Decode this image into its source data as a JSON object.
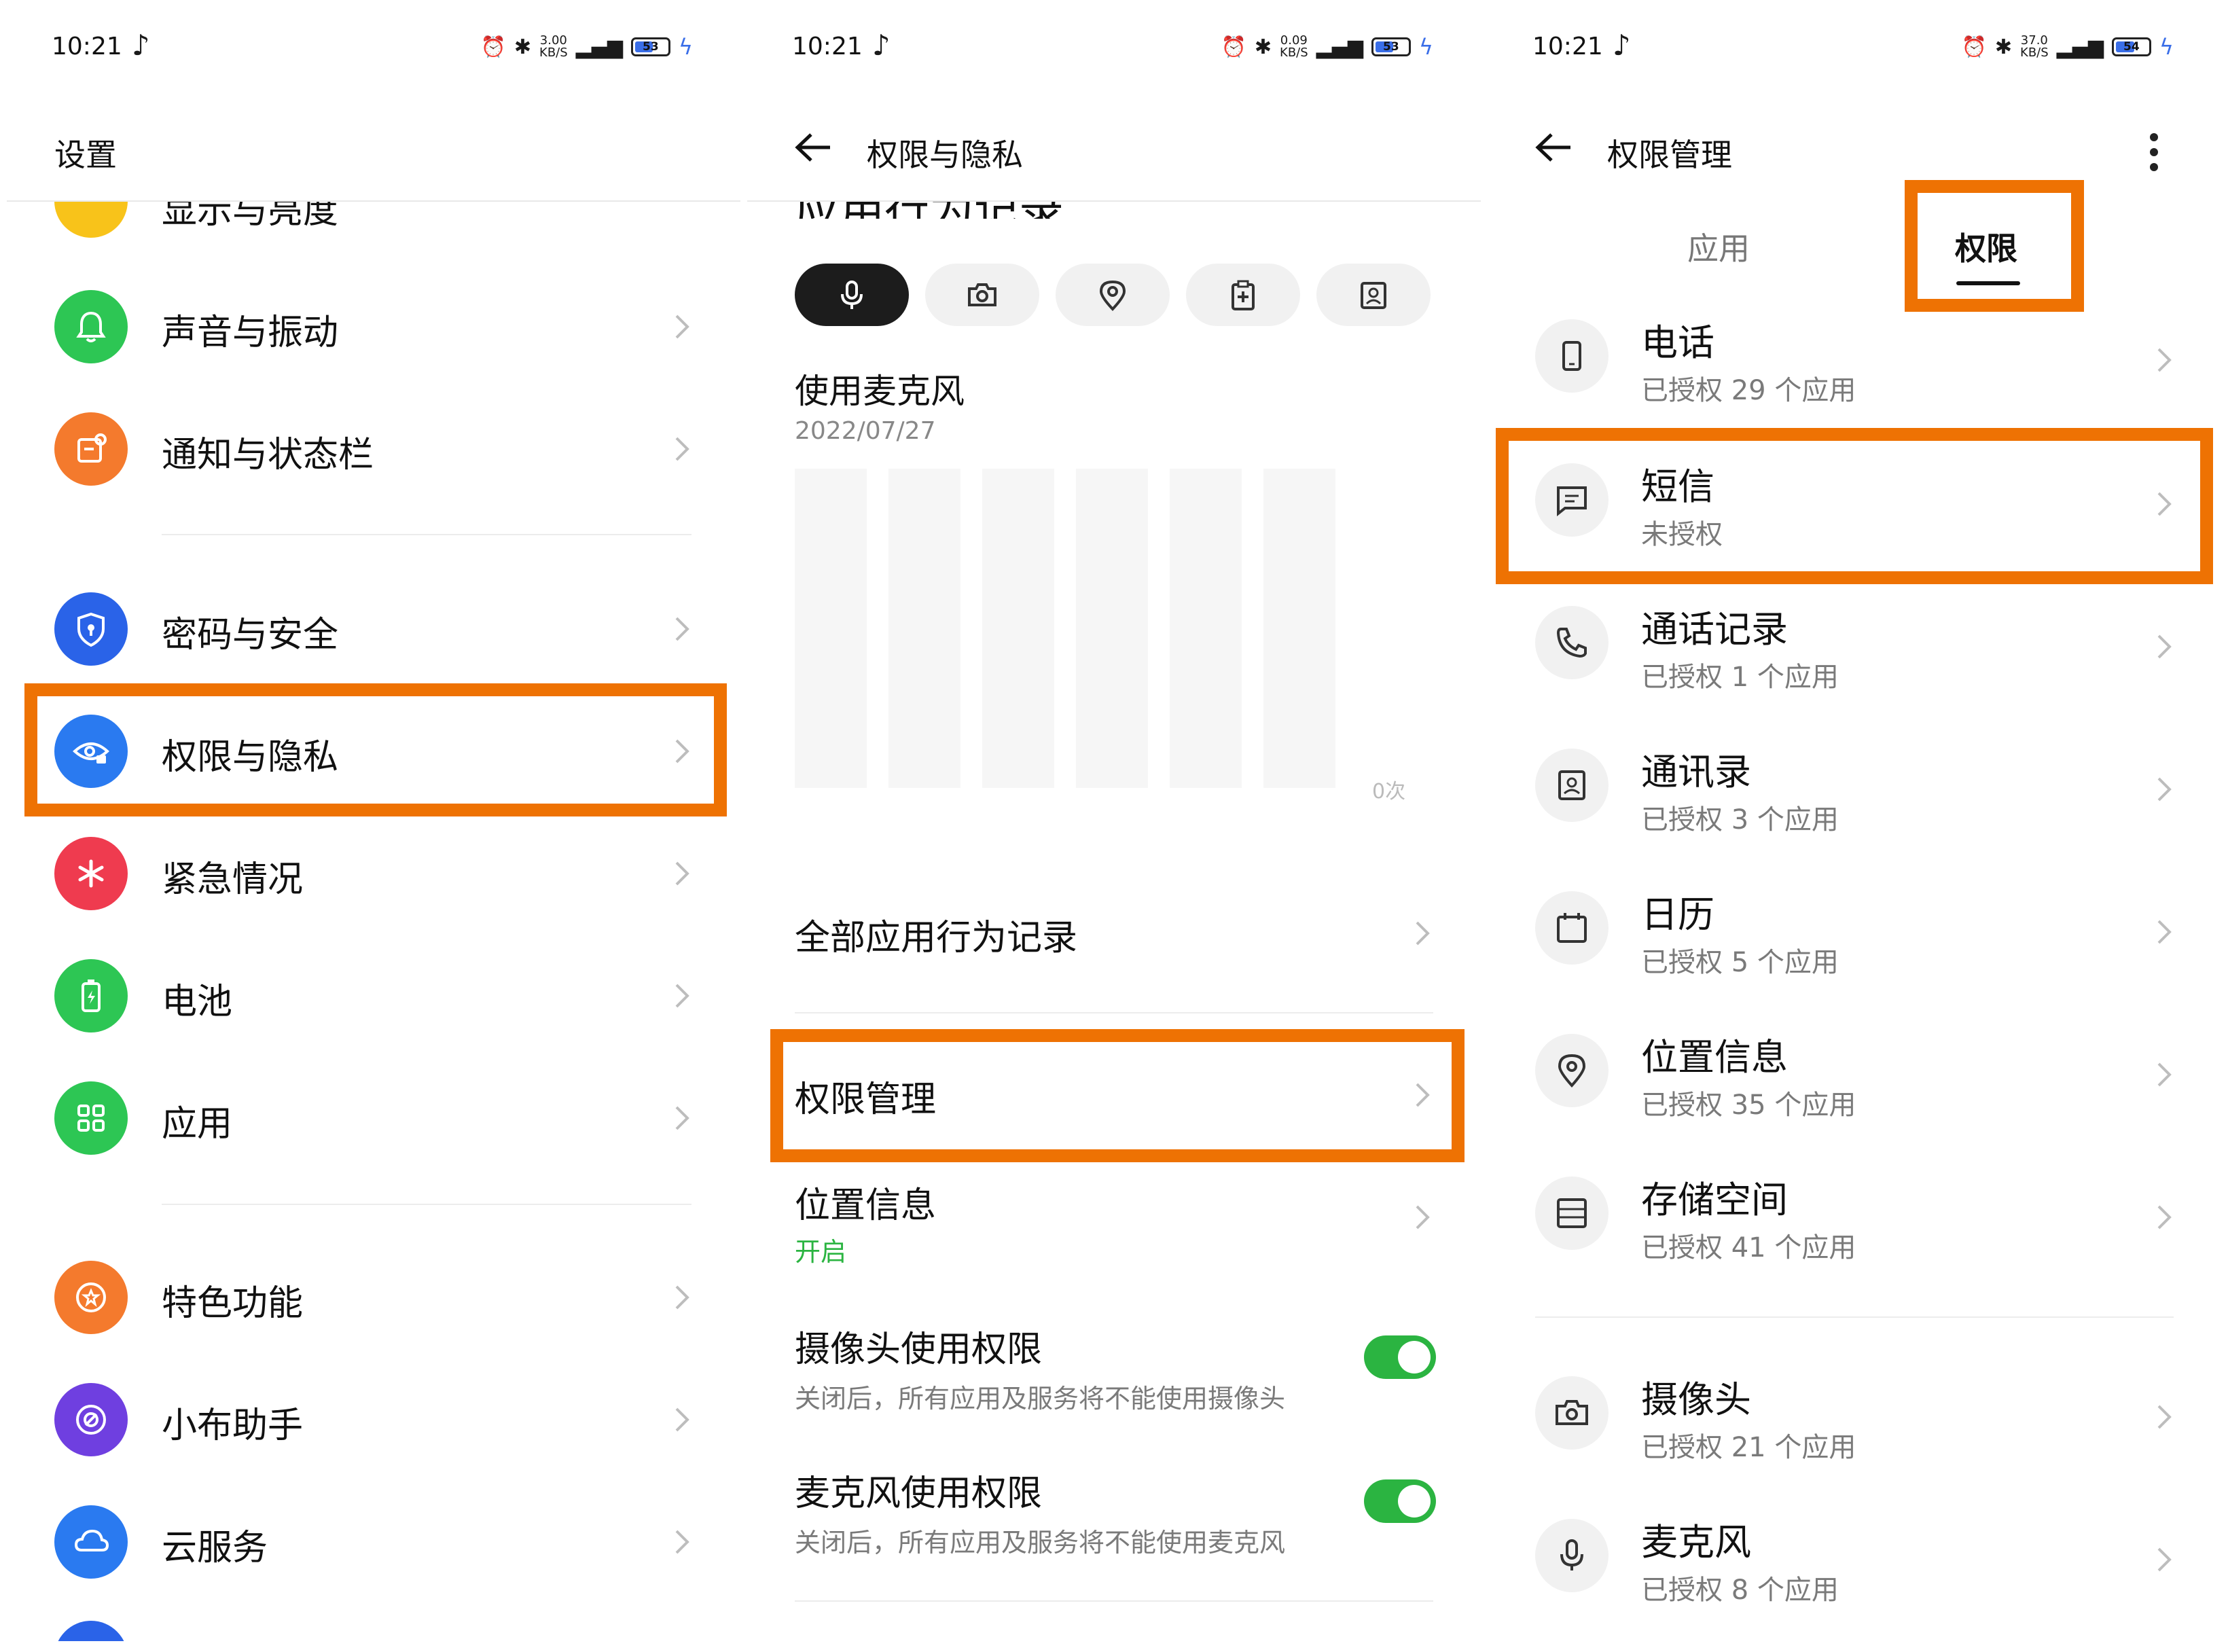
{
  "status": {
    "time": "10:21"
  },
  "panel1": {
    "title": "设置",
    "partial_item": "显示与亮度",
    "items": [
      {
        "label": "声音与振动",
        "color": "#2dc654"
      },
      {
        "label": "通知与状态栏",
        "color": "#f47a2d"
      },
      {
        "label": "密码与安全",
        "color": "#2a63e8"
      },
      {
        "label": "权限与隐私",
        "color": "#2a7af0"
      },
      {
        "label": "紧急情况",
        "color": "#ef3b4f"
      },
      {
        "label": "电池",
        "color": "#2dc654"
      },
      {
        "label": "应用",
        "color": "#2dc654"
      },
      {
        "label": "特色功能",
        "color": "#f47a2d"
      },
      {
        "label": "小布助手",
        "color": "#6f3fe0"
      },
      {
        "label": "云服务",
        "color": "#2a7af0"
      }
    ]
  },
  "panel2": {
    "title": "权限与隐私",
    "partial_heading": "应用行为记录",
    "usage_title": "使用麦克风",
    "usage_date": "2022/07/27",
    "chart_axis_label": "0次",
    "all_records": "全部应用行为记录",
    "permission_mgmt": "权限管理",
    "location_title": "位置信息",
    "location_status": "开启",
    "camera_title": "摄像头使用权限",
    "camera_sub": "关闭后，所有应用及服务将不能使用摄像头",
    "mic_title": "麦克风使用权限",
    "mic_sub": "关闭后，所有应用及服务将不能使用麦克风",
    "accent_green": "#2bb441"
  },
  "panel3": {
    "title": "权限管理",
    "tab_apps": "应用",
    "tab_perms": "权限",
    "items": [
      {
        "title": "电话",
        "sub": "已授权 29 个应用"
      },
      {
        "title": "短信",
        "sub": "未授权"
      },
      {
        "title": "通话记录",
        "sub": "已授权 1 个应用"
      },
      {
        "title": "通讯录",
        "sub": "已授权 3 个应用"
      },
      {
        "title": "日历",
        "sub": "已授权 5 个应用"
      },
      {
        "title": "位置信息",
        "sub": "已授权 35 个应用"
      },
      {
        "title": "存储空间",
        "sub": "已授权 41 个应用"
      },
      {
        "title": "摄像头",
        "sub": "已授权 21 个应用"
      },
      {
        "title": "麦克风",
        "sub": "已授权 8 个应用"
      }
    ]
  },
  "highlight_color": "#ee7203"
}
